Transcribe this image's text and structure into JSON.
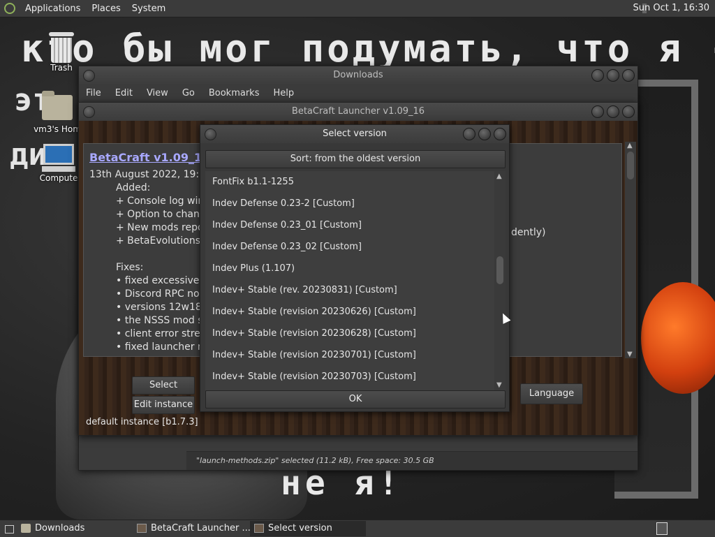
{
  "top_panel": {
    "menus": [
      "Applications",
      "Places",
      "System"
    ],
    "clock": "Sun Oct  1, 16:30"
  },
  "wallpaper": {
    "line1": "кто бы мог подумать, что я -",
    "left1": "эт",
    "left2": "ди",
    "bottom": "не я!"
  },
  "desktop_icons": [
    {
      "label": "Trash",
      "icon": "trash-icon"
    },
    {
      "label": "vm3's Hom",
      "icon": "home-folder-icon"
    },
    {
      "label": "Compute",
      "icon": "computer-icon"
    }
  ],
  "downloads_window": {
    "title": "Downloads",
    "menu": [
      "File",
      "Edit",
      "View",
      "Go",
      "Bookmarks",
      "Help"
    ],
    "status": "\"launch-methods.zip\" selected (11.2 kB), Free space: 30.5 GB"
  },
  "betacraft_window": {
    "title": "BetaCraft Launcher v1.09_16",
    "changelog_title": "BetaCraft v1.09_16 (e",
    "changelog_lines": [
      "13th August 2022, 19:00",
      "Added:",
      "+ Console log wind",
      "+ Option to change",
      "+ New mods repos",
      "+ BetaEvolutions s",
      "",
      "Fixes:",
      "• fixed excessive a",
      "• Discord RPC not",
      "• versions 12w18a",
      "• the NSSS mod s",
      "• client error strean",
      "• fixed launcher no"
    ],
    "overflow_text": "dently)",
    "select_version_button": "Select version",
    "edit_instance_button": "Edit instance",
    "language_button": "Language",
    "instance_label": "default instance [b1.7.3]"
  },
  "select_version_dialog": {
    "title": "Select version",
    "sort_button": "Sort: from the oldest version",
    "versions": [
      "FontFix b1.1-1255",
      "Indev Defense 0.23-2 [Custom]",
      "Indev Defense 0.23_01 [Custom]",
      "Indev Defense 0.23_02 [Custom]",
      "Indev Plus (1.107)",
      "Indev+ Stable (rev. 20230831) [Custom]",
      "Indev+ Stable (revision 20230626) [Custom]",
      "Indev+ Stable (revision 20230628) [Custom]",
      "Indev+ Stable (revision 20230701) [Custom]",
      "Indev+ Stable (revision 20230703) [Custom]"
    ],
    "ok_button": "OK"
  },
  "taskbar": {
    "tasks": [
      {
        "label": "Downloads",
        "icon": "folder-icon"
      },
      {
        "label": "BetaCraft Launcher ...",
        "icon": "betacraft-icon"
      },
      {
        "label": "Select version",
        "icon": "betacraft-icon"
      }
    ]
  }
}
